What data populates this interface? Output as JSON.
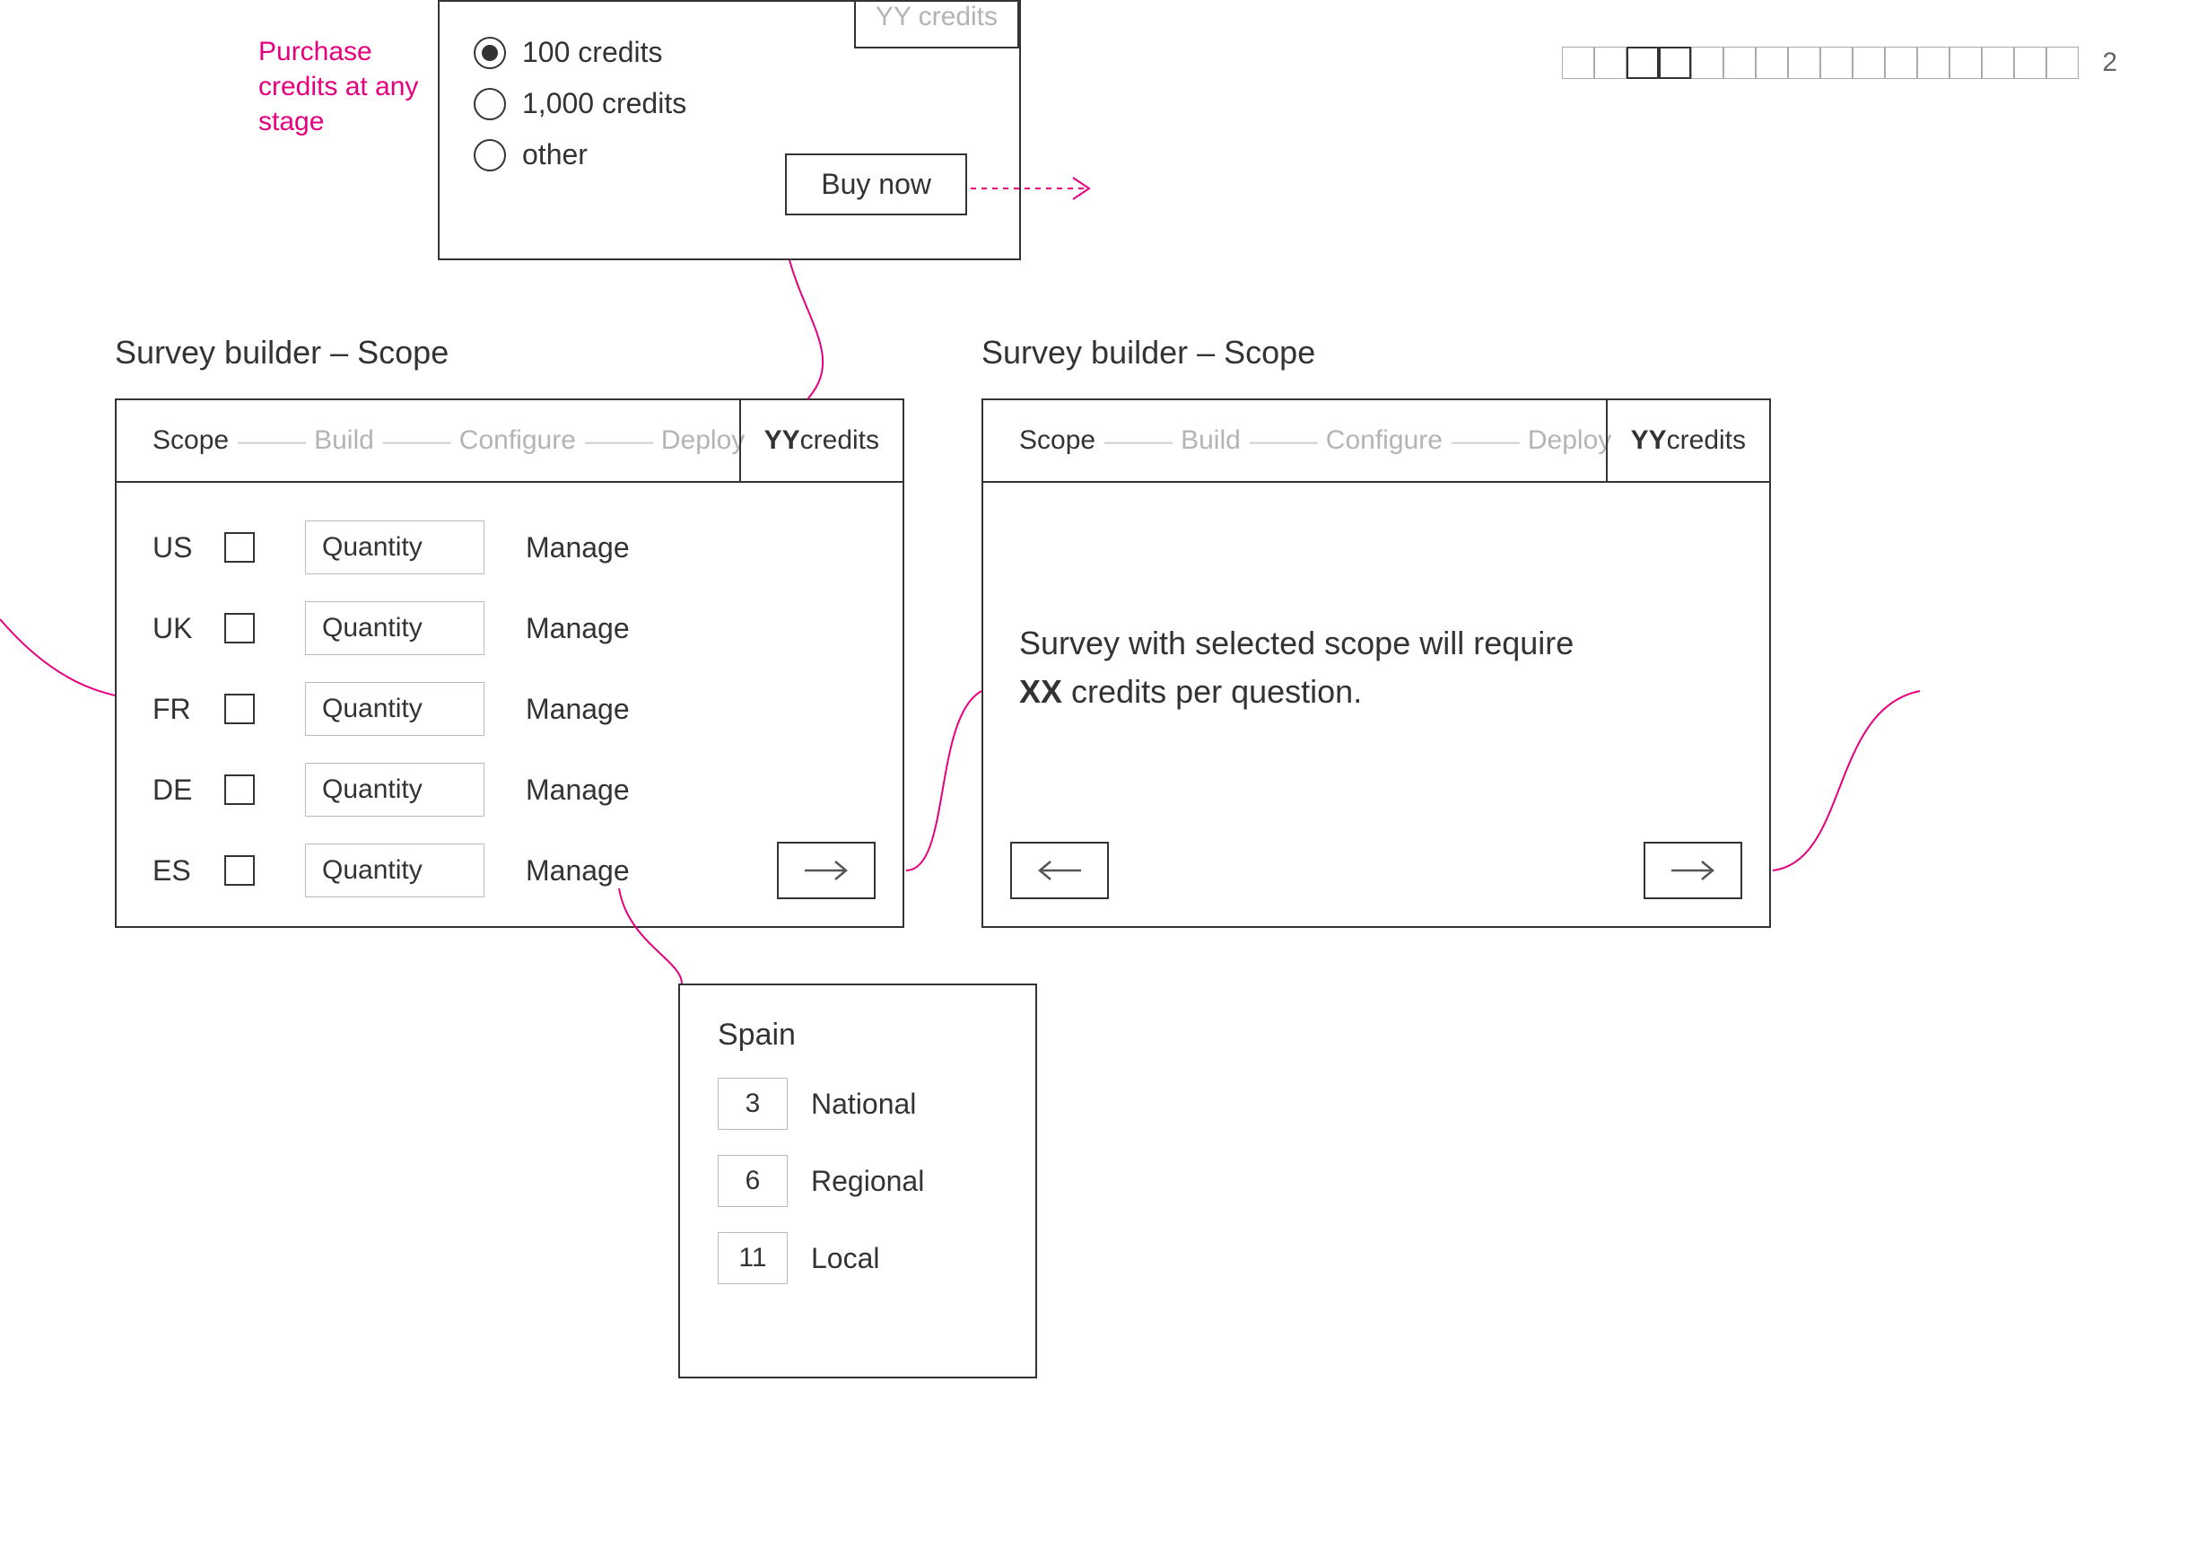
{
  "annotation": {
    "purchase": "Purchase credits at any stage"
  },
  "pagination": {
    "cells": 16,
    "marked": [
      2,
      3
    ],
    "page_number": "2"
  },
  "credits_panel": {
    "yy_chip": "YY credits",
    "options": [
      "100 credits",
      "1,000 credits",
      "other"
    ],
    "selected_index": 0,
    "buy_label": "Buy now"
  },
  "titles": {
    "left": "Survey builder – Scope",
    "right": "Survey builder – Scope"
  },
  "scope_panel": {
    "crumbs": [
      "Scope",
      "Build",
      "Configure",
      "Deploy"
    ],
    "active_index": 0,
    "yy_label_bold": "YY",
    "yy_label_rest": " credits",
    "countries": [
      "US",
      "UK",
      "FR",
      "DE",
      "ES"
    ],
    "qty_placeholder": "Quantity",
    "manage_label": "Manage"
  },
  "cost_panel": {
    "line1": "Survey with selected scope will require ",
    "xx": "XX",
    "line2": " credits per question."
  },
  "spain": {
    "title": "Spain",
    "rows": [
      {
        "n": "3",
        "label": "National"
      },
      {
        "n": "6",
        "label": "Regional"
      },
      {
        "n": "11",
        "label": "Local"
      }
    ]
  }
}
